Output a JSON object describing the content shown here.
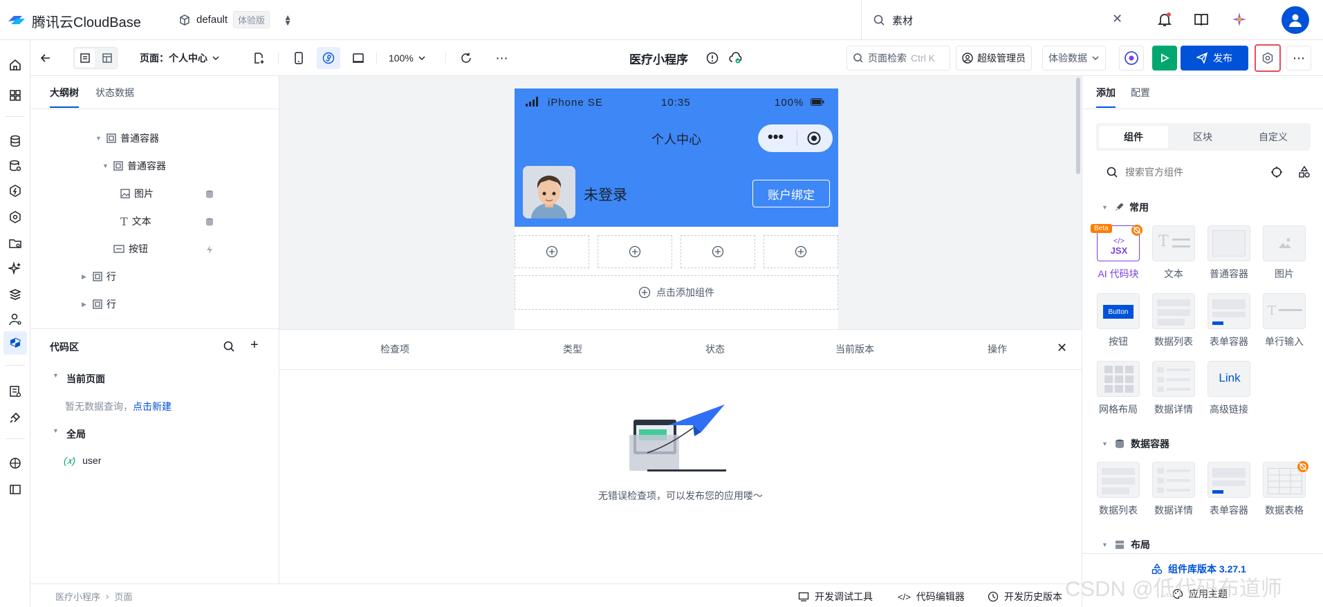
{
  "topbar": {
    "brand": "腾讯云CloudBase",
    "env_name": "default",
    "env_tag": "体验版",
    "search_value": "素材"
  },
  "toolbar": {
    "page_label": "页面：个人中心",
    "zoom": "100%",
    "app_title": "医疗小程序",
    "page_search": "页面检索",
    "page_search_shortcut": "Ctrl K",
    "admin_label": "超级管理员",
    "data_mode": "体验数据",
    "publish_label": "发布"
  },
  "outline": {
    "tabs": [
      "大纲树",
      "状态数据"
    ],
    "nodes": [
      "普通容器",
      "普通容器",
      "图片",
      "文本",
      "按钮",
      "行",
      "行"
    ]
  },
  "code": {
    "title": "代码区",
    "current_page": "当前页面",
    "empty_text": "暂无数据查询，",
    "new_link": "点击新建",
    "global": "全局",
    "var_prefix": "(𝑥)",
    "var_name": "user"
  },
  "phone": {
    "carrier": "iPhone SE",
    "time": "10:35",
    "battery": "100%",
    "title": "个人中心",
    "user_name": "未登录",
    "bind_button": "账户绑定",
    "add_component": "点击添加组件"
  },
  "check": {
    "columns": [
      "检查项",
      "类型",
      "状态",
      "当前版本",
      "操作"
    ],
    "empty_message": "无错误检查项，可以发布您的应用喽～"
  },
  "rightpanel": {
    "tabs": [
      "添加",
      "配置"
    ],
    "segments": [
      "组件",
      "区块",
      "自定义"
    ],
    "search_placeholder": "搜索官方组件",
    "sections": {
      "common": "常用",
      "data_container": "数据容器",
      "layout": "布局"
    },
    "common_items": [
      "AI 代码块",
      "文本",
      "普通容器",
      "图片",
      "按钮",
      "数据列表",
      "表单容器",
      "单行输入",
      "网格布局",
      "数据详情",
      "高级链接"
    ],
    "data_items": [
      "数据列表",
      "数据详情",
      "表单容器",
      "数据表格"
    ],
    "beta_tag": "Beta",
    "jsx_label": "JSX",
    "button_thumb": "Button",
    "link_thumb": "Link",
    "lib_version": "组件库版本 3.27.1",
    "apply_theme": "应用主题"
  },
  "bottombar": {
    "breadcrumb": [
      "医疗小程序",
      "页面"
    ],
    "debug_tool": "开发调试工具",
    "code_editor": "代码编辑器",
    "history": "开发历史版本"
  },
  "watermark": "CSDN @低代码布道师",
  "colors": {
    "primary": "#0052d9",
    "phone_header": "#3d87f6",
    "run_green": "#00a870",
    "highlight_red": "#e34d59",
    "ai_purple": "#7b3fe4"
  }
}
